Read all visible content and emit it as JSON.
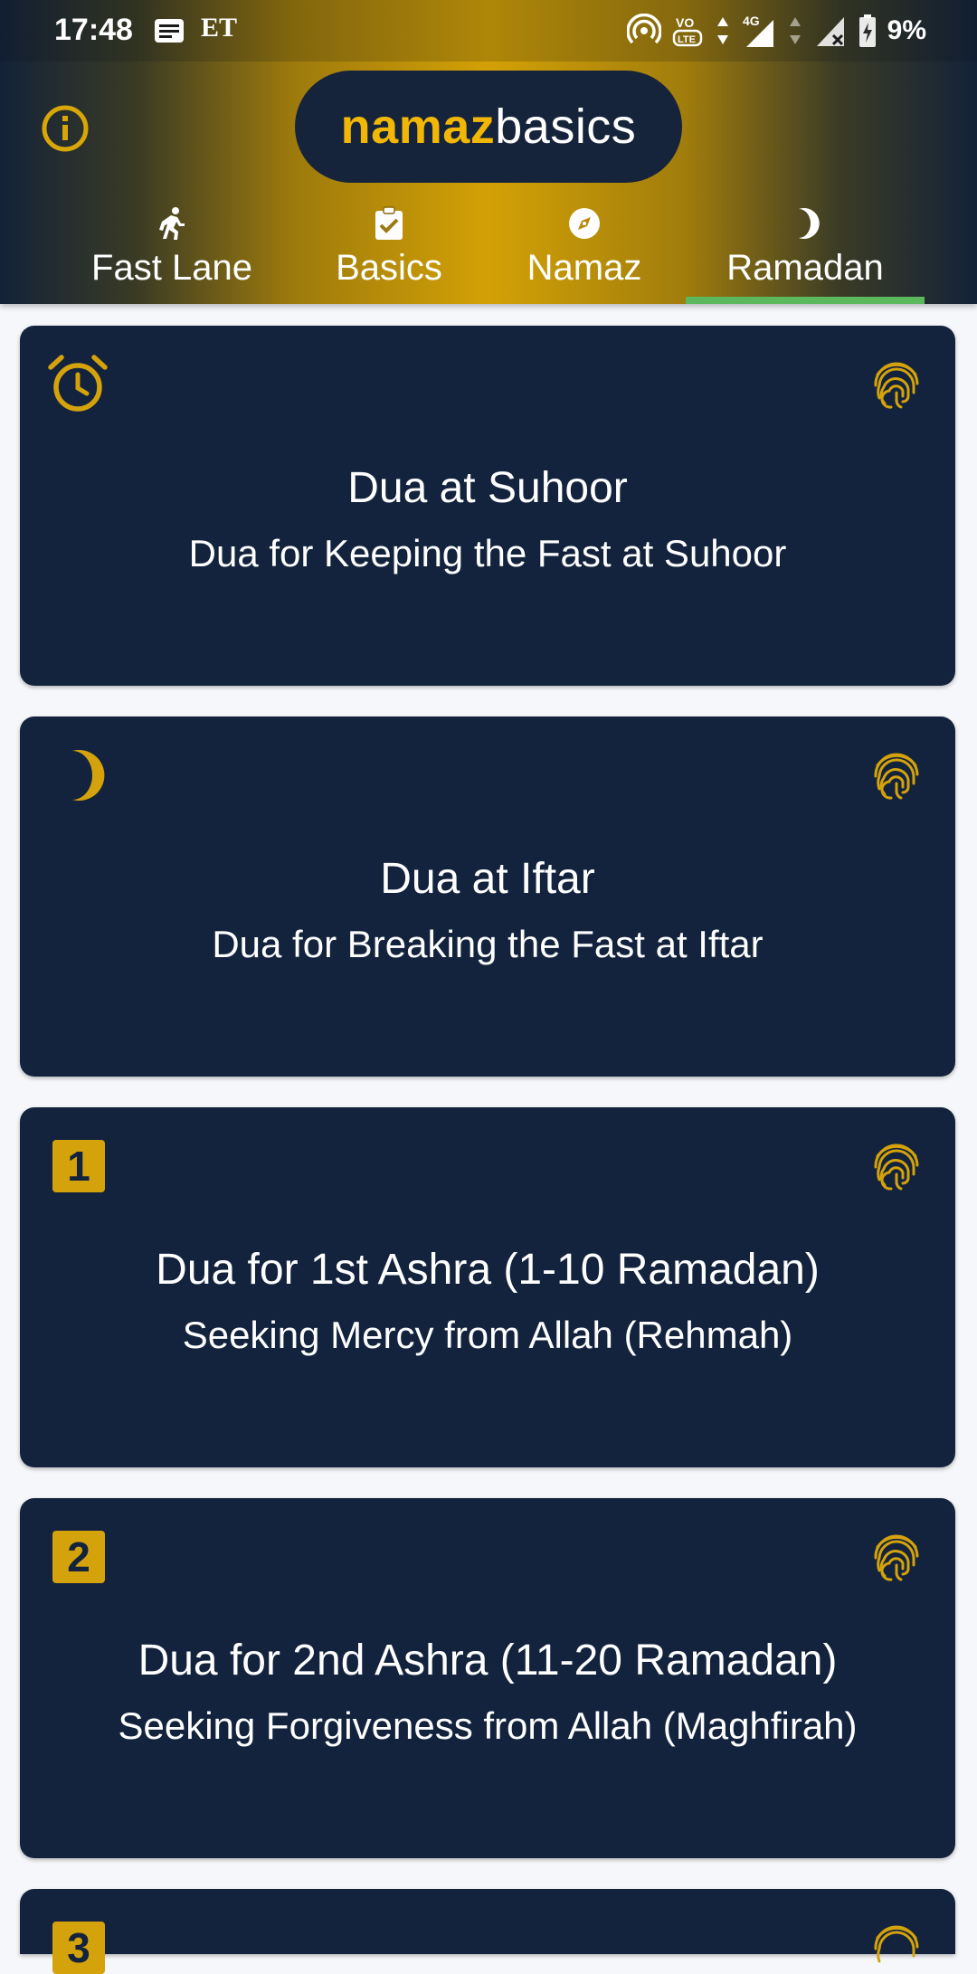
{
  "status_bar": {
    "time": "17:48",
    "carrier_app": "ET",
    "network": "4G",
    "battery": "9%"
  },
  "header": {
    "logo_part1": "namaz",
    "logo_part2": "basics",
    "info_icon": "info-circle-icon"
  },
  "tabs": [
    {
      "label": "Fast Lane",
      "icon": "running-person-icon"
    },
    {
      "label": "Basics",
      "icon": "clipboard-check-icon"
    },
    {
      "label": "Namaz",
      "icon": "compass-icon"
    },
    {
      "label": "Ramadan",
      "icon": "crescent-moon-icon",
      "active": true
    }
  ],
  "cards": [
    {
      "title": "Dua at Suhoor",
      "subtitle": "Dua for Keeping the Fast at Suhoor",
      "icon": "alarm-clock-icon"
    },
    {
      "title": "Dua at Iftar",
      "subtitle": "Dua for Breaking the Fast at Iftar",
      "icon": "crescent-moon-icon"
    },
    {
      "title": "Dua for 1st Ashra (1-10 Ramadan)",
      "subtitle": "Seeking Mercy from Allah (Rehmah)",
      "badge": "1"
    },
    {
      "title": "Dua for 2nd Ashra (11-20 Ramadan)",
      "subtitle": "Seeking Forgiveness from Allah (Maghfirah)",
      "badge": "2"
    },
    {
      "title": "",
      "subtitle": "",
      "badge": "3"
    }
  ],
  "colors": {
    "card_bg": "#13233d",
    "accent_gold": "#d4a20a",
    "tab_indicator": "#5cb85c",
    "page_bg": "#f6f7fa"
  }
}
